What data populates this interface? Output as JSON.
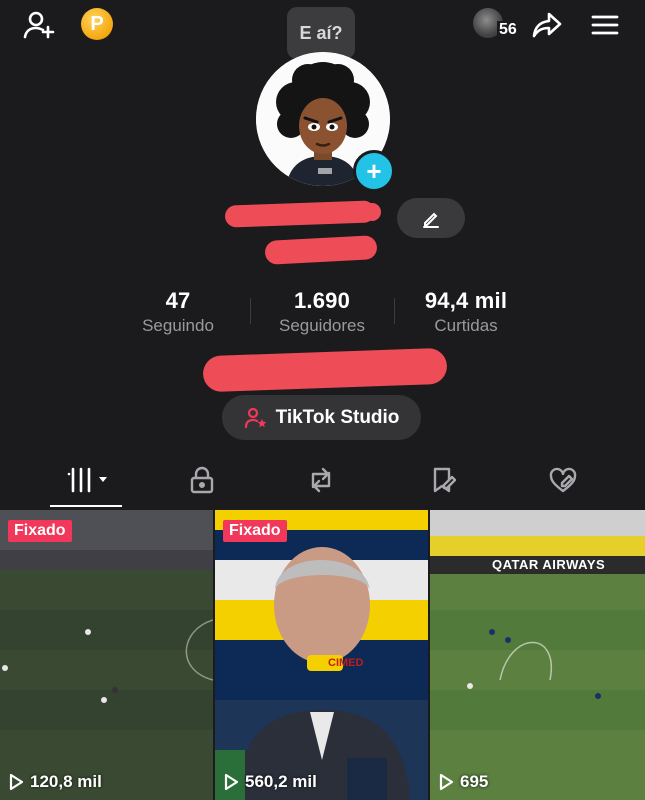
{
  "header": {
    "points_badge": "P",
    "friends_count": "56",
    "bubble_text": "E aí?"
  },
  "stats": [
    {
      "value": "47",
      "label": "Seguindo"
    },
    {
      "value": "1.690",
      "label": "Seguidores"
    },
    {
      "value": "94,4 mil",
      "label": "Curtidas"
    }
  ],
  "studio_button": {
    "label": "TikTok Studio"
  },
  "tabs": [
    {
      "name": "videos",
      "icon": "grid-icon",
      "active": true
    },
    {
      "name": "private",
      "icon": "lock-icon",
      "active": false
    },
    {
      "name": "reposts",
      "icon": "repost-icon",
      "active": false
    },
    {
      "name": "favorites",
      "icon": "bookmark-icon",
      "active": false
    },
    {
      "name": "liked",
      "icon": "heart-icon",
      "active": false
    }
  ],
  "videos": [
    {
      "pinned_label": "Fixado",
      "views": "120,8 mil"
    },
    {
      "pinned_label": "Fixado",
      "views": "560,2 mil",
      "overlay_text": "CIMED"
    },
    {
      "pinned_label": "",
      "views": "695",
      "overlay_text": "QATAR AIRWAYS"
    }
  ],
  "colors": {
    "background": "#1b1b1d",
    "accent_red": "#ee4d57",
    "pin_badge": "#f2385a",
    "avatar_add": "#22c3e6"
  }
}
